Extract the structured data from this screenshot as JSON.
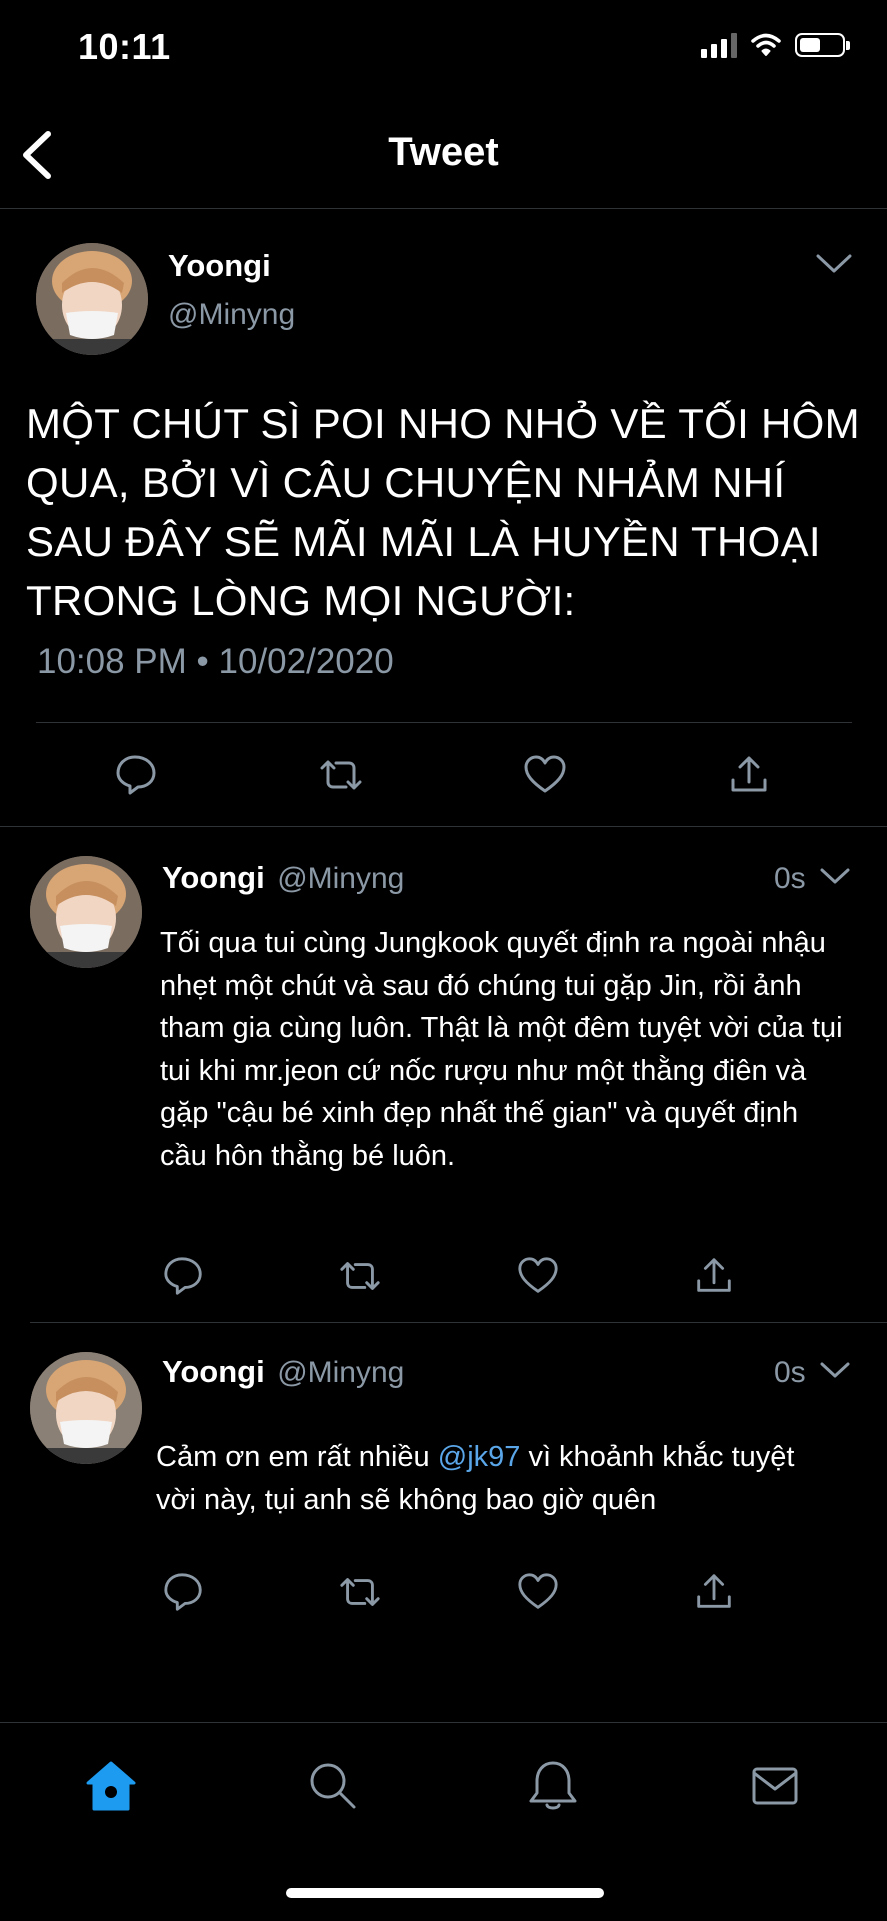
{
  "status_bar": {
    "time": "10:11"
  },
  "header": {
    "title": "Tweet"
  },
  "main_tweet": {
    "name": "Yoongi",
    "handle": "@Minyng",
    "text": "MỘT CHÚT SÌ POI NHO NHỎ VỀ TỐI HÔM QUA, BỞI VÌ CÂU CHUYỆN NHẢM NHÍ SAU ĐÂY SẼ MÃI MÃI LÀ HUYỀN THOẠI TRONG LÒNG MỌI NGƯỜI:",
    "timestamp": "10:08 PM • 10/02/2020"
  },
  "replies": [
    {
      "name": "Yoongi",
      "handle": "@Minyng",
      "time": "0s",
      "text": "Tối qua tui cùng Jungkook quyết định ra ngoài nhậu nhẹt một chút và sau đó chúng tui gặp Jin, rồi ảnh tham gia cùng luôn. Thật là một đêm tuyệt vời của tụi tui khi mr.jeon cứ nốc rượu như một thằng điên và gặp \"cậu bé xinh đẹp nhất thế gian\" và quyết định cầu hôn thằng bé luôn."
    },
    {
      "name": "Yoongi",
      "handle": "@Minyng",
      "time": "0s",
      "text_before": "Cảm ơn em rất nhiều ",
      "mention": "@jk97",
      "text_after": " vì khoảnh khắc tuyệt vời này, tụi anh sẽ không bao giờ quên"
    }
  ],
  "colors": {
    "background": "#000000",
    "accent": "#1d9bf0",
    "secondary_text": "#8b98a5",
    "divider": "#2f3336"
  },
  "icons": [
    "back-arrow-icon",
    "reply-icon",
    "retweet-icon",
    "like-icon",
    "share-icon",
    "chevron-down-icon",
    "home-icon",
    "search-icon",
    "notifications-icon",
    "messages-icon"
  ]
}
